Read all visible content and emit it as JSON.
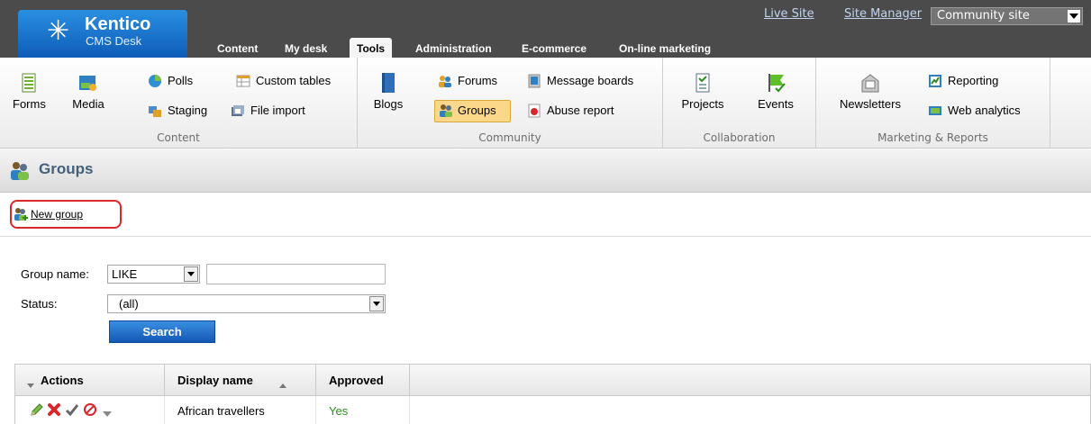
{
  "header": {
    "logo": {
      "brand": "Kentico",
      "sub": "CMS Desk"
    },
    "links": [
      {
        "label": "Live Site"
      },
      {
        "label": "Site Manager"
      }
    ],
    "site_selector": {
      "value": "Community site"
    },
    "tabs": [
      {
        "label": "Content"
      },
      {
        "label": "My desk"
      },
      {
        "label": "Tools",
        "active": true
      },
      {
        "label": "Administration"
      },
      {
        "label": "E-commerce"
      },
      {
        "label": "On-line marketing"
      }
    ]
  },
  "ribbon": {
    "groups": [
      {
        "label": "Content",
        "items": {
          "forms": "Forms",
          "media": "Media",
          "polls": "Polls",
          "staging": "Staging",
          "custom_tables": "Custom tables",
          "file_import": "File import"
        }
      },
      {
        "label": "Community",
        "items": {
          "blogs": "Blogs",
          "forums": "Forums",
          "groups": "Groups",
          "message_boards": "Message boards",
          "abuse_report": "Abuse report"
        }
      },
      {
        "label": "Collaboration",
        "items": {
          "projects": "Projects",
          "events": "Events"
        }
      },
      {
        "label": "Marketing & Reports",
        "items": {
          "newsletters": "Newsletters",
          "reporting": "Reporting",
          "web_analytics": "Web analytics"
        }
      }
    ]
  },
  "page": {
    "title": "Groups"
  },
  "actions": {
    "new_group": "New group"
  },
  "filter": {
    "group_name_label": "Group name:",
    "group_name_operator": "LIKE",
    "group_name_value": "",
    "status_label": "Status:",
    "status_value": "(all)",
    "search_label": "Search"
  },
  "grid": {
    "columns": [
      {
        "label": "Actions"
      },
      {
        "label": "Display name"
      },
      {
        "label": "Approved"
      }
    ],
    "rows": [
      {
        "display_name": "African travellers",
        "approved": "Yes"
      }
    ]
  },
  "colors": {
    "header_bg": "#4b4b4b",
    "accent_blue": "#1a6fcf",
    "highlight_red": "#d8282a",
    "approved_green": "#2e8b22",
    "title_text": "#44607a"
  },
  "icons": [
    "kentico-logo-icon",
    "dropdown-arrow-icon",
    "forms-icon",
    "media-icon",
    "polls-icon",
    "staging-icon",
    "custom-tables-icon",
    "file-import-icon",
    "blogs-icon",
    "forums-icon",
    "groups-icon",
    "message-boards-icon",
    "abuse-report-icon",
    "projects-icon",
    "events-icon",
    "newsletters-icon",
    "reporting-icon",
    "web-analytics-icon",
    "new-group-icon",
    "edit-icon",
    "delete-icon",
    "approve-icon",
    "reject-icon",
    "more-actions-icon",
    "sort-menu-icon",
    "sort-ascending-icon"
  ]
}
